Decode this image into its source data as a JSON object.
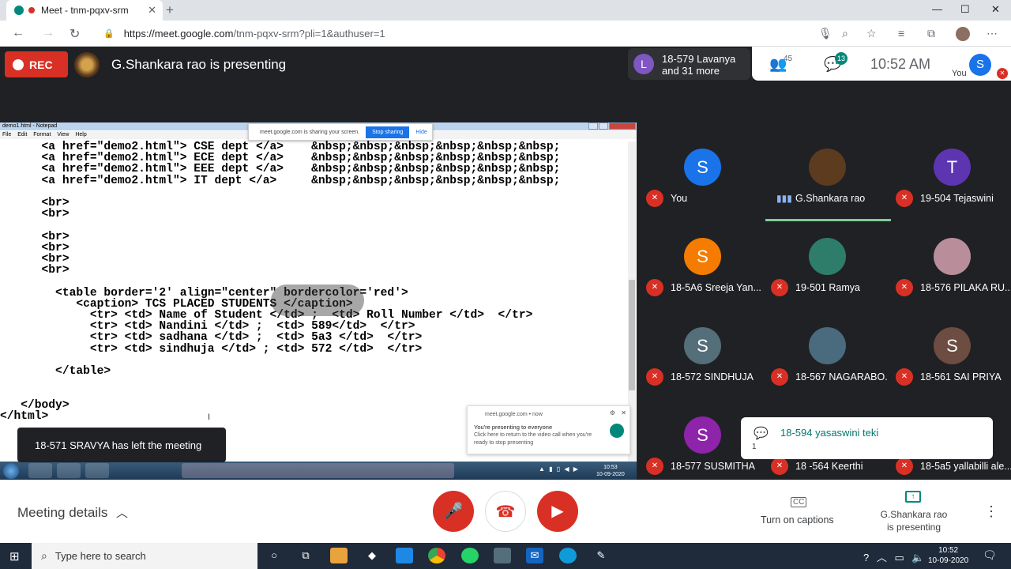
{
  "browser": {
    "tab_title": "Meet - tnm-pqxv-srm",
    "url_host": "https://meet.google.com",
    "url_rest": "/tnm-pqxv-srm?pli=1&authuser=1"
  },
  "meet": {
    "rec_label": "REC",
    "presenting_text": "G.Shankara rao is presenting",
    "joined": {
      "avatar": "L",
      "line1": "18-579 Lavanya",
      "line2": "and 31 more"
    },
    "people_count": "45",
    "chat_count": "13",
    "time": "10:52 AM",
    "self_avatar": "S",
    "self_label": "You"
  },
  "screen": {
    "notepad_title": "demo1.html - Notepad",
    "notepad_menu": "File Edit Format View Help",
    "share_banner_text": "meet.google.com is sharing your screen.",
    "stop_sharing": "Stop sharing",
    "hide": "Hide",
    "code": "      <a href=\"demo2.html\"> CSE dept </a>    &nbsp;&nbsp;&nbsp;&nbsp;&nbsp;&nbsp;\n      <a href=\"demo2.html\"> ECE dept </a>    &nbsp;&nbsp;&nbsp;&nbsp;&nbsp;&nbsp;\n      <a href=\"demo2.html\"> EEE dept </a>    &nbsp;&nbsp;&nbsp;&nbsp;&nbsp;&nbsp;\n      <a href=\"demo2.html\"> IT dept </a>     &nbsp;&nbsp;&nbsp;&nbsp;&nbsp;&nbsp;\n\n      <br>\n      <br>\n\n      <br>\n      <br>\n      <br>\n      <br>\n\n        <table border='2' align=\"center\" bordercolor='red'>\n           <caption> TCS PLACED STUDENTS </caption>\n             <tr> <td> Name of Student </td> ;  <td> Roll Number </td>  </tr>\n             <tr> <td> Nandini </td> ;  <td> 589</td>  </tr>\n             <tr> <td> sadhana </td> ;  <td> 5a3 </td>  </tr>\n             <tr> <td> sindhuja </td> ; <td> 572 </td>  </tr>\n\n        </table>\n\n\n   </body>\n</html>",
    "toast": "18-571 SRAVYA has left the meeting",
    "notif_source": "meet.google.com  •  now",
    "notif_title": "You're presenting to everyone",
    "notif_body": "Click here to return to the video call when you're ready to stop presenting",
    "win7_time": "10:53",
    "win7_date": "10-09-2020"
  },
  "participants": [
    {
      "name": "You",
      "initial": "S",
      "color": "#1a73e8"
    },
    {
      "name": "G.Shankara rao",
      "initial": "",
      "color": "#5d3b1e",
      "speaking": true
    },
    {
      "name": "19-504 Tejaswini",
      "initial": "T",
      "color": "#5e35b1"
    },
    {
      "name": "18-5A6 Sreeja Yan...",
      "initial": "S",
      "color": "#f57c00"
    },
    {
      "name": "19-501 Ramya",
      "initial": "",
      "color": "#2e7d6a"
    },
    {
      "name": "18-576 PILAKA RU...",
      "initial": "",
      "color": "#b98e9a"
    },
    {
      "name": "18-572 SINDHUJA",
      "initial": "S",
      "color": "#546e7a"
    },
    {
      "name": "18-567 NAGARABO...",
      "initial": "",
      "color": "#4a6a7e"
    },
    {
      "name": "18-561 SAI PRIYA",
      "initial": "S",
      "color": "#6d4c41"
    },
    {
      "name": "18-577 SUSMITHA",
      "initial": "S",
      "color": "#8e24aa"
    },
    {
      "name": "18 -564 Keerthi",
      "initial": "",
      "color": "#202124"
    },
    {
      "name": "18-5a5 yallabilli ale...",
      "initial": "",
      "color": "#202124"
    }
  ],
  "chat_toast": {
    "from": "18-594 yasaswini teki",
    "message": "1"
  },
  "controls": {
    "meeting_details": "Meeting details",
    "captions": "Turn on captions",
    "captions_icon": "CC",
    "presenting_line1": "G.Shankara rao",
    "presenting_line2": "is presenting"
  },
  "taskbar": {
    "search_placeholder": "Type here to search",
    "time": "10:52",
    "date": "10-09-2020",
    "notif_count": "13"
  }
}
